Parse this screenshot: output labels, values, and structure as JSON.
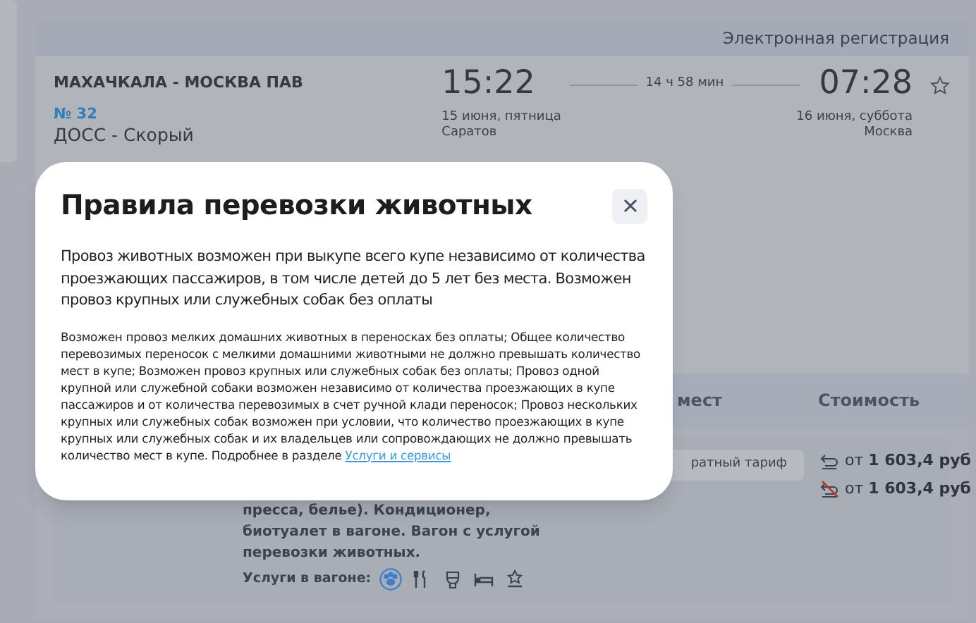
{
  "header": {
    "e_registration": "Электронная регистрация"
  },
  "train": {
    "route": "МАХАЧКАЛА - МОСКВА ПАВ",
    "number": "№ 32",
    "type": "ДОСС - Скорый",
    "favorite": false
  },
  "departure": {
    "time": "15:22",
    "date": "15 июня, пятница",
    "station": "Саратов"
  },
  "duration": "14 ч 58 мин",
  "arrival": {
    "time": "07:28",
    "date": "16 июня, суббота",
    "station": "Москва"
  },
  "columns": [
    "мест",
    "Стоимость"
  ],
  "tariff": "ратный тариф",
  "prices": [
    {
      "kind": "refundable",
      "text": "от **1 603,4 руб**"
    },
    {
      "kind": "nonrefundable",
      "text": "от **1 603,4 руб**"
    }
  ],
  "description": [
    "пресса, белье). Кондиционер,",
    "биотуалет в вагоне. Вагон с услугой",
    "перевозки животных."
  ],
  "services": {
    "label": "Услуги в вагоне:",
    "items": [
      {
        "kind": "pets",
        "selected": true
      },
      {
        "kind": "food",
        "selected": false
      },
      {
        "kind": "toilet",
        "selected": false
      },
      {
        "kind": "bed",
        "selected": false
      },
      {
        "kind": "comfort",
        "selected": false
      }
    ]
  },
  "modal": {
    "title": "Правила перевозки животных",
    "lead": "Провоз животных возможен при выкупе всего купе независимо от количества проезжающих пассажиров, в том числе детей до 5 лет без места. Возможен провоз крупных или служебных собак без оплаты",
    "details": "Возможен провоз мелких домашних животных в переносках без оплаты; Общее количество перевозимых переносок с мелкими домашними животными не должно превышать количество мест в купе; Возможен провоз крупных или служебных собак без оплаты; Провоз одной крупной или служебной собаки возможен независимо от количества проезжающих в купе пассажиров и от количества перевозимых в счет ручной клади переносок; Провоз нескольких крупных или служебных собак возможен при условии, что количество проезжающих в купе крупных или служебных собак и их владельцев или сопровождающих не должно превышать количество мест в купе. Подробнее в разделе",
    "link": "Услуги и сервисы"
  }
}
